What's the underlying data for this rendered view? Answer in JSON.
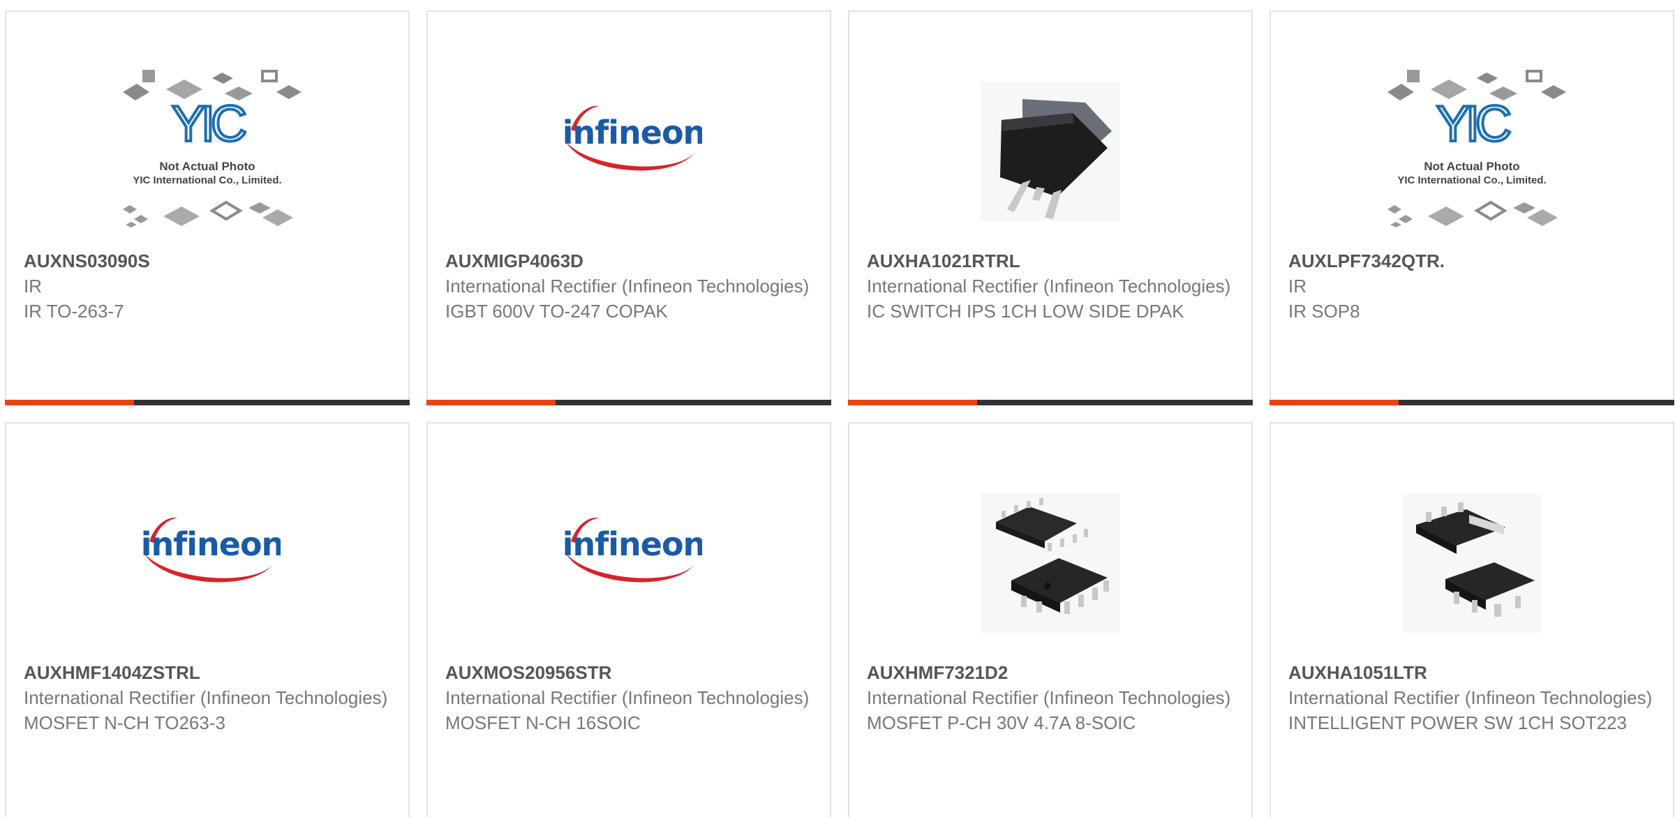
{
  "colors": {
    "accent": "#e84413",
    "bar_dark": "#333333",
    "infineon_blue": "#1a5aa6",
    "infineon_red": "#d8232a",
    "yic_blue": "#1b6fb5"
  },
  "products": [
    {
      "part_number": "AUXNS03090S",
      "manufacturer": "IR",
      "description": "IR TO-263-7",
      "image": "yic-placeholder",
      "placeholder_line1": "Not Actual Photo",
      "placeholder_line2": "YIC International Co., Limited.",
      "logo_text": "YIC"
    },
    {
      "part_number": "AUXMIGP4063D",
      "manufacturer": "International Rectifier (Infineon Technologies)",
      "description": "IGBT 600V TO-247 COPAK",
      "image": "infineon-logo",
      "logo_text": "infineon"
    },
    {
      "part_number": "AUXHA1021RTRL",
      "manufacturer": "International Rectifier (Infineon Technologies)",
      "description": "IC SWITCH IPS 1CH LOW SIDE DPAK",
      "image": "dpak-chip"
    },
    {
      "part_number": "AUXLPF7342QTR.",
      "manufacturer": "IR",
      "description": "IR SOP8",
      "image": "yic-placeholder",
      "placeholder_line1": "Not Actual Photo",
      "placeholder_line2": "YIC International Co., Limited.",
      "logo_text": "YIC"
    },
    {
      "part_number": "AUXHMF1404ZSTRL",
      "manufacturer": "International Rectifier (Infineon Technologies)",
      "description": "MOSFET N-CH TO263-3",
      "image": "infineon-logo",
      "logo_text": "infineon"
    },
    {
      "part_number": "AUXMOS20956STR",
      "manufacturer": "International Rectifier (Infineon Technologies)",
      "description": "MOSFET N-CH 16SOIC",
      "image": "infineon-logo",
      "logo_text": "infineon"
    },
    {
      "part_number": "AUXHMF7321D2",
      "manufacturer": "International Rectifier (Infineon Technologies)",
      "description": "MOSFET P-CH 30V 4.7A 8-SOIC",
      "image": "soic8-chip"
    },
    {
      "part_number": "AUXHA1051LTR",
      "manufacturer": "International Rectifier (Infineon Technologies)",
      "description": "INTELLIGENT POWER SW 1CH SOT223",
      "image": "sot223-chip"
    }
  ]
}
